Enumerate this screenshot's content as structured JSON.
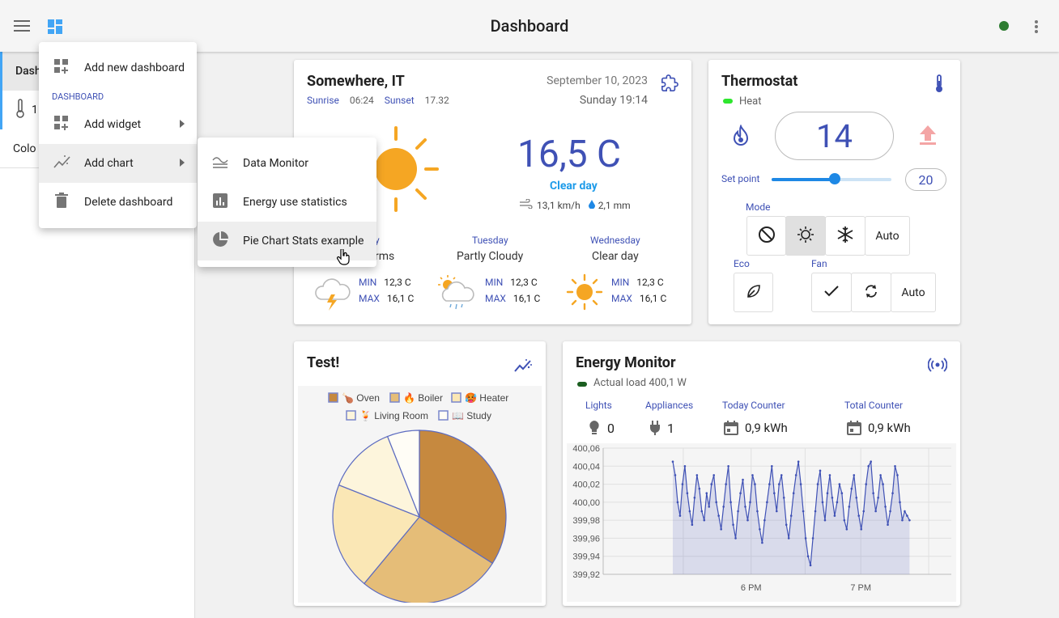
{
  "header": {
    "title": "Dashboard",
    "status_color": "#2e7d32"
  },
  "sidebar": {
    "items": [
      {
        "label": "Dash"
      },
      {
        "label": "1"
      },
      {
        "label": "Colo"
      }
    ]
  },
  "menu": {
    "add_dashboard": "Add new dashboard",
    "section": "DASHBOARD",
    "add_widget": "Add widget",
    "add_chart": "Add chart",
    "delete_dashboard": "Delete dashboard"
  },
  "submenu": {
    "items": [
      "Data Monitor",
      "Energy use statistics",
      "Pie Chart Stats example"
    ]
  },
  "weather": {
    "location": "Somewhere, IT",
    "date": "September 10, 2023",
    "day_time": "Sunday 19:14",
    "sunrise_label": "Sunrise",
    "sunrise": "06:24",
    "sunset_label": "Sunset",
    "sunset": "17.32",
    "temperature": "16,5 C",
    "condition": "Clear day",
    "wind": "13,1 km/h",
    "rain": "2,1 mm",
    "forecast": [
      {
        "day": "y",
        "condition": "orms",
        "min_label": "MIN",
        "min": "12,3 C",
        "max_label": "MAX",
        "max": "16,1 C"
      },
      {
        "day": "Tuesday",
        "condition": "Partly Cloudy",
        "min_label": "MIN",
        "min": "12,3 C",
        "max_label": "MAX",
        "max": "16,1 C"
      },
      {
        "day": "Wednesday",
        "condition": "Clear day",
        "min_label": "MIN",
        "min": "12,3 C",
        "max_label": "MAX",
        "max": "16,1 C"
      }
    ]
  },
  "thermostat": {
    "title": "Thermostat",
    "status": "Heat",
    "value": "14",
    "setpoint_label": "Set point",
    "setpoint": "20",
    "setpoint_fraction": 0.53,
    "mode_label": "Mode",
    "mode_auto": "Auto",
    "eco_label": "Eco",
    "fan_label": "Fan",
    "fan_auto": "Auto"
  },
  "pie_card": {
    "title": "Test!"
  },
  "energy": {
    "title": "Energy Monitor",
    "load": "Actual load 400,1 W",
    "lights_label": "Lights",
    "lights": "0",
    "appliances_label": "Appliances",
    "appliances": "1",
    "today_label": "Today Counter",
    "today": "0,9 kWh",
    "total_label": "Total Counter",
    "total": "0,9 kWh"
  },
  "chart_data": [
    {
      "type": "pie",
      "legend": [
        "🍗 Oven",
        "🔥 Boiler",
        "🥵 Heater",
        "🍹 Living Room",
        "📖 Study"
      ],
      "values": [
        34,
        27,
        20,
        13,
        6
      ],
      "colors": [
        "#c6893f",
        "#e5bd78",
        "#fae7b5",
        "#fdf5dc",
        "#fffdf6"
      ],
      "legend_placement": "top"
    },
    {
      "type": "line",
      "yticks": [
        "400,06",
        "400,04",
        "400,02",
        "400,00",
        "399,98",
        "399,96",
        "399,94",
        "399,92"
      ],
      "xticks": [
        "6 PM",
        "7 PM"
      ],
      "ylim": [
        399.92,
        400.06
      ],
      "xlim": [
        0,
        1
      ],
      "x_ticks_pos": [
        0.425,
        0.74
      ],
      "x_start": 0.2,
      "x_end": 0.88,
      "values": [
        400.045,
        400.03,
        400.0,
        399.985,
        400.02,
        400.04,
        400.01,
        399.99,
        399.975,
        400.005,
        400.03,
        400.015,
        399.99,
        399.98,
        400.01,
        399.995,
        400.02,
        400.03,
        400.0,
        399.985,
        399.97,
        399.995,
        400.02,
        400.04,
        400.0,
        399.975,
        399.96,
        399.99,
        400.01,
        400.025,
        399.995,
        399.98,
        400.0,
        400.03,
        400.02,
        399.99,
        399.97,
        399.955,
        399.98,
        400.0,
        400.02,
        400.04,
        400.01,
        399.99,
        400.02,
        400.03,
        400.005,
        399.975,
        399.96,
        399.985,
        400.01,
        400.03,
        400.045,
        400.02,
        399.99,
        399.96,
        399.94,
        399.93,
        399.96,
        399.99,
        400.02,
        400.035,
        400.0,
        399.98,
        400.01,
        400.03,
        400.005,
        399.985,
        400.0,
        400.02,
        400.01,
        399.98,
        399.97,
        399.995,
        400.015,
        400.03,
        400.005,
        399.985,
        399.97,
        399.99,
        400.02,
        400.04,
        400.045,
        400.01,
        399.99,
        400.005,
        400.03,
        400.02,
        399.995,
        399.975,
        399.99,
        400.01,
        400.04,
        400.03,
        400.0,
        399.98,
        399.99,
        399.985,
        399.98
      ]
    }
  ]
}
